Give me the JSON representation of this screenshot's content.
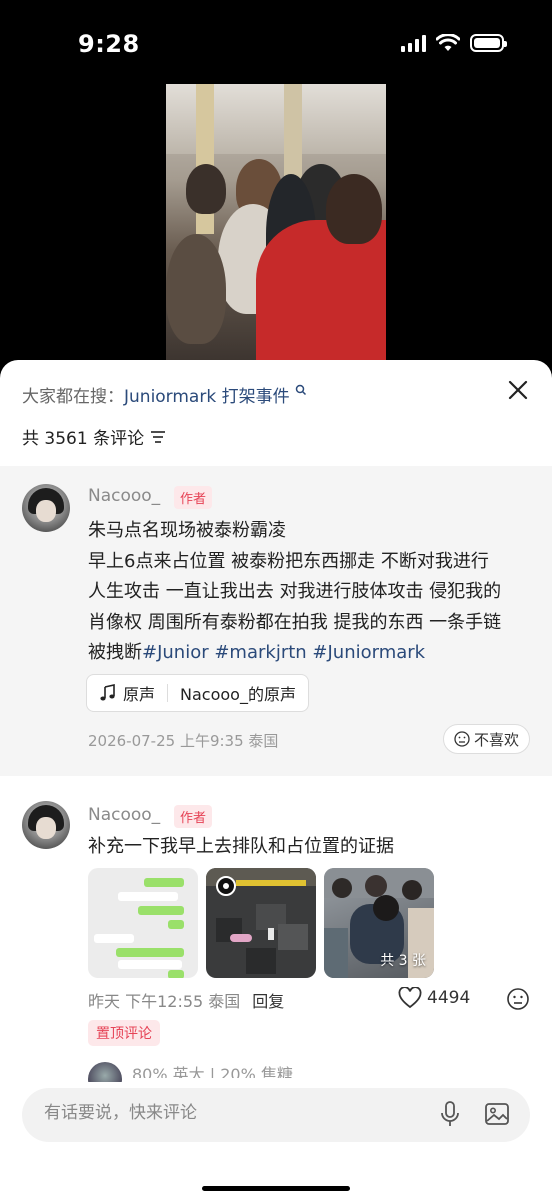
{
  "status_bar": {
    "time": "9:28"
  },
  "search_suggest": {
    "prefix": "大家都在搜：",
    "keyword": "Juniormark 打架事件"
  },
  "comments_header": {
    "count_text": "共 3561 条评论"
  },
  "pinned_comment": {
    "username": "Nacooo_",
    "author_tag": "作者",
    "lines": [
      "朱马点名现场被泰粉霸凌",
      "早上6点来占位置 被泰粉把东西挪走 不断对我进行",
      "人生攻击 一直让我出去 对我进行肢体攻击 侵犯我的",
      "肖像权 周围所有泰粉都在拍我 提我的东西 一条手链",
      "被拽断"
    ],
    "hashtags": "#Junior #markjrtn #Juniormark",
    "sound": {
      "label": "原声",
      "name": "Nacooo_的原声"
    },
    "meta": "2026-07-25 上午9:35 泰国",
    "dislike_label": "不喜欢"
  },
  "comment": {
    "username": "Nacooo_",
    "author_tag": "作者",
    "text": "补充一下我早上去排队和占位置的证据",
    "photo_count": "共 3 张",
    "meta": "昨天 下午12:55 泰国",
    "reply_label": "回复",
    "likes": "4494",
    "pinned_tag": "置顶评论"
  },
  "next_comment_preview": "80% 英大 | 20% 焦糖",
  "input": {
    "placeholder": "有话要说，快来评论"
  }
}
